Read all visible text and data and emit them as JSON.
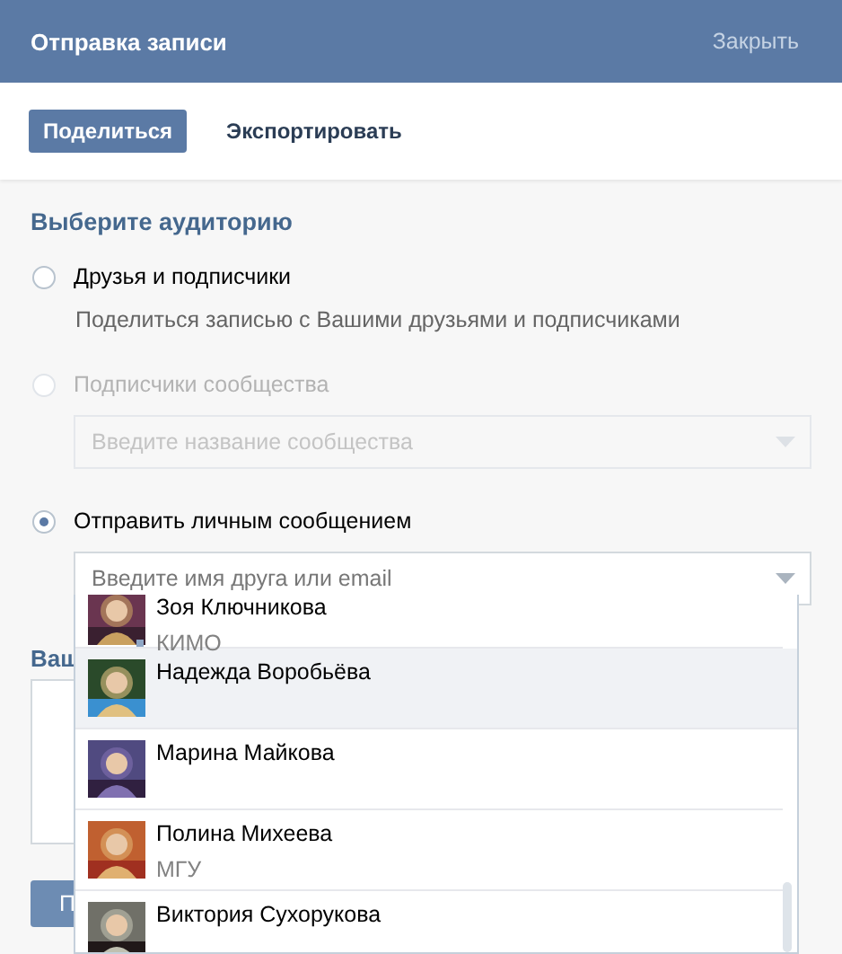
{
  "window": {
    "title": "Отправка записи",
    "close_link": "Закрыть"
  },
  "tabs": [
    {
      "label": "Поделиться",
      "selected": true
    },
    {
      "label": "Экспортировать",
      "selected": false
    }
  ],
  "audience": {
    "heading": "Выберите аудиторию",
    "options": [
      {
        "kind": "description",
        "label": "Друзья и подписчики",
        "selected": false,
        "disabled": false,
        "description": "Поделиться записью с Вашими друзьями и подписчиками"
      },
      {
        "kind": "field",
        "label": "Подписчики сообщества",
        "selected": false,
        "disabled": true,
        "placeholder": "Введите название сообщества"
      },
      {
        "kind": "field",
        "label": "Отправить личным сообщением",
        "selected": true,
        "disabled": false,
        "placeholder": "Введите имя друга или email"
      }
    ]
  },
  "friend_list": [
    {
      "name": "Зоя Ключникова",
      "subtitle": "КИМО",
      "selected": false,
      "online": true
    },
    {
      "name": "Надежда Воробьёва",
      "selected": true,
      "online": false
    },
    {
      "name": "Марина Майкова",
      "selected": false,
      "online": false
    },
    {
      "name": "Полина Михеева",
      "subtitle": "МГУ",
      "selected": false,
      "online": false
    },
    {
      "name": "Виктория Сухорукова",
      "selected": false,
      "online": false
    }
  ],
  "comment": {
    "label": "Ваш"
  },
  "submit_button": "П"
}
